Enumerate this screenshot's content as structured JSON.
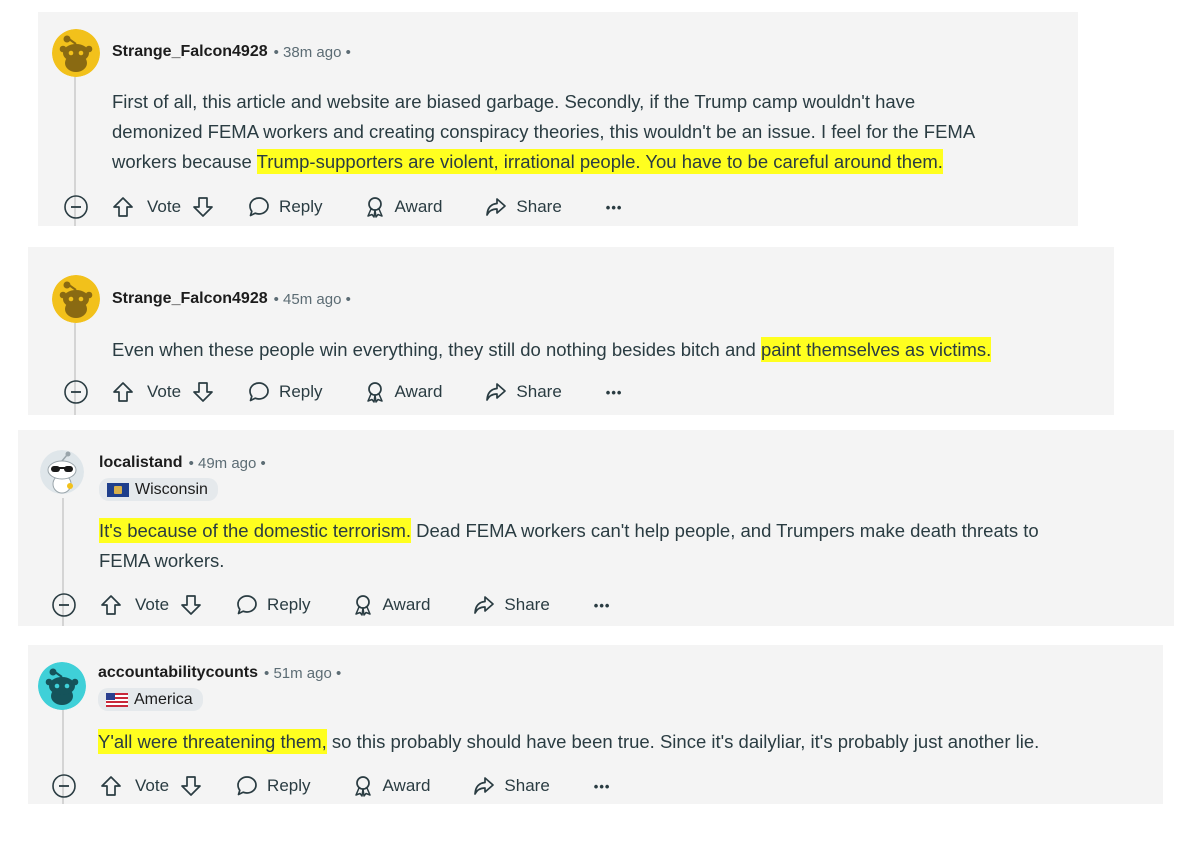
{
  "comments": [
    {
      "username": "Strange_Falcon4928",
      "time": "• 38m ago •",
      "avatar_color": "#f2c11b",
      "avatar_icon": "reddit-snoo-icon",
      "lines": [
        [
          "First of all, this article and website are biased garbage. Secondly, if the Trump camp wouldn't have"
        ],
        [
          "demonized FEMA workers and creating conspiracy theories, this wouldn't be an issue. I feel for the FEMA"
        ],
        [
          "workers because ",
          "Trump-supporters are violent, irrational people. You have to be careful around them."
        ]
      ]
    },
    {
      "username": "Strange_Falcon4928",
      "time": "• 45m ago •",
      "avatar_color": "#f2c11b",
      "avatar_icon": "reddit-snoo-icon",
      "lines": [
        [
          "Even when these people win everything, they still do nothing besides bitch and ",
          "paint themselves as victims."
        ]
      ]
    },
    {
      "username": "localistand",
      "time": "• 49m ago •",
      "flair": "Wisconsin",
      "flair_icon": "wisconsin-flag-icon",
      "avatar_icon": "snoo-sunglasses-icon",
      "lines": [
        [
          "",
          "It's because of the domestic terrorism.",
          " Dead FEMA workers can't help people, and Trumpers make death threats to"
        ],
        [
          "FEMA workers."
        ]
      ]
    },
    {
      "username": "accountabilitycounts",
      "time": "• 51m ago •",
      "flair": "America",
      "flair_icon": "us-flag-icon",
      "avatar_color": "#3fd0d8",
      "avatar_icon": "reddit-snoo-icon",
      "lines": [
        [
          "",
          "Y'all were threatening them,",
          " so this probably should have been true. Since it's dailyliar, it's probably just another lie."
        ]
      ]
    }
  ],
  "actions": {
    "collapse_icon": "collapse-minus-icon",
    "vote_label": "Vote",
    "reply_label": "Reply",
    "award_label": "Award",
    "share_label": "Share",
    "more_label": "•••"
  },
  "colors": {
    "highlight": "#ffff1f",
    "card_background": "#f4f4f4",
    "flair_background": "#e5e9ec"
  }
}
